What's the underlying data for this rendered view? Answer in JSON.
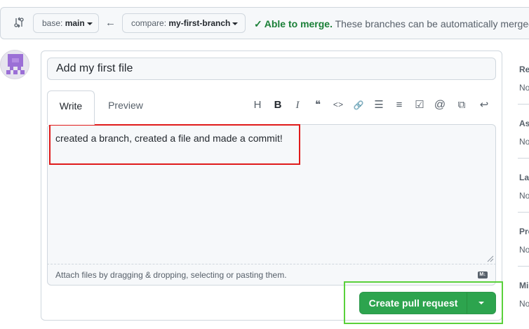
{
  "compare": {
    "base_label": "base:",
    "base_value": "main",
    "compare_label": "compare:",
    "compare_value": "my-first-branch",
    "status_strong": "Able to merge.",
    "status_text": "These branches can be automatically merged."
  },
  "form": {
    "title_value": "Add my first file",
    "tab_write": "Write",
    "tab_preview": "Preview",
    "body_text": "created a branch, created a file and made a commit!",
    "attach_hint": "Attach files by dragging & dropping, selecting or pasting them.",
    "markdown_badge": "M↓",
    "create_button": "Create pull request"
  },
  "toolbar": [
    {
      "icon": "heading-icon",
      "glyph": "H"
    },
    {
      "icon": "bold-icon",
      "glyph": "B"
    },
    {
      "icon": "italic-icon",
      "glyph": "I"
    },
    {
      "icon": "quote-icon",
      "glyph": "❝"
    },
    {
      "icon": "code-icon",
      "glyph": "<>"
    },
    {
      "icon": "link-icon",
      "glyph": "🔗"
    },
    {
      "icon": "bulleted-list-icon",
      "glyph": "☰"
    },
    {
      "icon": "numbered-list-icon",
      "glyph": "≡"
    },
    {
      "icon": "task-list-icon",
      "glyph": "☑"
    },
    {
      "icon": "mention-icon",
      "glyph": "@"
    },
    {
      "icon": "reference-icon",
      "glyph": "⧉"
    },
    {
      "icon": "reply-icon",
      "glyph": "↩"
    }
  ],
  "sidebar": [
    {
      "head": "Re",
      "value": "No"
    },
    {
      "head": "As",
      "value": "No"
    },
    {
      "head": "Lal",
      "value": "No"
    },
    {
      "head": "Pro",
      "value": "No"
    },
    {
      "head": "Mi",
      "value": "No"
    }
  ],
  "colors": {
    "merge_green": "#1a7f37",
    "button_green": "#2da44e",
    "highlight_red": "#e01b1b",
    "highlight_green": "#5ad13b"
  }
}
